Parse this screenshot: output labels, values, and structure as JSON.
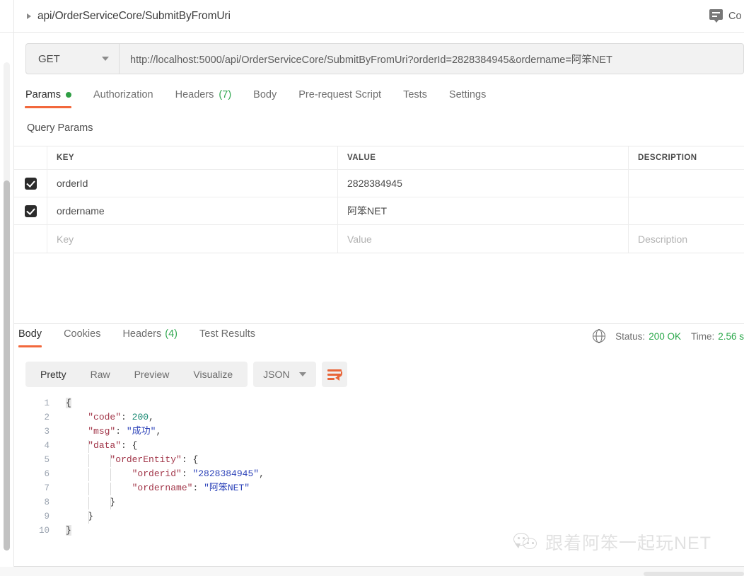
{
  "header": {
    "breadcrumb": "api/OrderServiceCore/SubmitByFromUri",
    "caret_icon": "chevron-right-icon",
    "comments_icon": "comment-icon",
    "comments_label": "Co"
  },
  "request": {
    "method": "GET",
    "method_caret_icon": "chevron-down-icon",
    "url": "http://localhost:5000/api/OrderServiceCore/SubmitByFromUri?orderId=2828384945&ordername=阿笨NET",
    "tabs": [
      {
        "label": "Params",
        "badge": "",
        "dot": true,
        "active": true
      },
      {
        "label": "Authorization",
        "badge": "",
        "dot": false,
        "active": false
      },
      {
        "label": "Headers",
        "badge": "(7)",
        "dot": false,
        "active": false
      },
      {
        "label": "Body",
        "badge": "",
        "dot": false,
        "active": false
      },
      {
        "label": "Pre-request Script",
        "badge": "",
        "dot": false,
        "active": false
      },
      {
        "label": "Tests",
        "badge": "",
        "dot": false,
        "active": false
      },
      {
        "label": "Settings",
        "badge": "",
        "dot": false,
        "active": false
      }
    ],
    "section_title": "Query Params",
    "table": {
      "columns": [
        "KEY",
        "VALUE",
        "DESCRIPTION"
      ],
      "rows": [
        {
          "checked": true,
          "key": "orderId",
          "value": "2828384945",
          "description": ""
        },
        {
          "checked": true,
          "key": "ordername",
          "value": "阿笨NET",
          "description": ""
        }
      ],
      "placeholder_row": {
        "key": "Key",
        "value": "Value",
        "description": "Description"
      }
    }
  },
  "response": {
    "tabs": [
      {
        "label": "Body",
        "badge": "",
        "active": true
      },
      {
        "label": "Cookies",
        "badge": "",
        "active": false
      },
      {
        "label": "Headers",
        "badge": "(4)",
        "active": false
      },
      {
        "label": "Test Results",
        "badge": "",
        "active": false
      }
    ],
    "globe_icon": "globe-icon",
    "status_label": "Status:",
    "status_value": "200 OK",
    "time_label": "Time:",
    "time_value": "2.56 s",
    "view_modes": [
      "Pretty",
      "Raw",
      "Preview",
      "Visualize"
    ],
    "active_view_mode": "Pretty",
    "format": "JSON",
    "format_caret_icon": "chevron-down-icon",
    "wrap_icon": "word-wrap-icon",
    "body_lines": [
      {
        "no": "1",
        "segments": [
          {
            "t": "{",
            "c": "brace"
          }
        ]
      },
      {
        "no": "2",
        "segments": [
          {
            "t": "    ",
            "c": "punct"
          },
          {
            "t": "\"code\"",
            "c": "key"
          },
          {
            "t": ": ",
            "c": "punct"
          },
          {
            "t": "200",
            "c": "num"
          },
          {
            "t": ",",
            "c": "punct"
          }
        ]
      },
      {
        "no": "3",
        "segments": [
          {
            "t": "    ",
            "c": "punct"
          },
          {
            "t": "\"msg\"",
            "c": "key"
          },
          {
            "t": ": ",
            "c": "punct"
          },
          {
            "t": "\"成功\"",
            "c": "str"
          },
          {
            "t": ",",
            "c": "punct"
          }
        ]
      },
      {
        "no": "4",
        "segments": [
          {
            "t": "    ",
            "c": "punct"
          },
          {
            "t": "\"data\"",
            "c": "key"
          },
          {
            "t": ": ",
            "c": "punct"
          },
          {
            "t": "{",
            "c": "brace"
          }
        ]
      },
      {
        "no": "5",
        "segments": [
          {
            "t": "        ",
            "c": "punct"
          },
          {
            "t": "\"orderEntity\"",
            "c": "key"
          },
          {
            "t": ": ",
            "c": "punct"
          },
          {
            "t": "{",
            "c": "brace"
          }
        ]
      },
      {
        "no": "6",
        "segments": [
          {
            "t": "            ",
            "c": "punct"
          },
          {
            "t": "\"orderid\"",
            "c": "key"
          },
          {
            "t": ": ",
            "c": "punct"
          },
          {
            "t": "\"2828384945\"",
            "c": "str"
          },
          {
            "t": ",",
            "c": "punct"
          }
        ]
      },
      {
        "no": "7",
        "segments": [
          {
            "t": "            ",
            "c": "punct"
          },
          {
            "t": "\"ordername\"",
            "c": "key"
          },
          {
            "t": ": ",
            "c": "punct"
          },
          {
            "t": "\"阿笨NET\"",
            "c": "str"
          }
        ]
      },
      {
        "no": "8",
        "segments": [
          {
            "t": "        ",
            "c": "punct"
          },
          {
            "t": "}",
            "c": "brace"
          }
        ]
      },
      {
        "no": "9",
        "segments": [
          {
            "t": "    ",
            "c": "punct"
          },
          {
            "t": "}",
            "c": "brace"
          }
        ]
      },
      {
        "no": "10",
        "segments": [
          {
            "t": "}",
            "c": "brace"
          }
        ]
      }
    ]
  },
  "watermark": {
    "icon": "wechat-icon",
    "text": "跟着阿笨一起玩NET"
  }
}
